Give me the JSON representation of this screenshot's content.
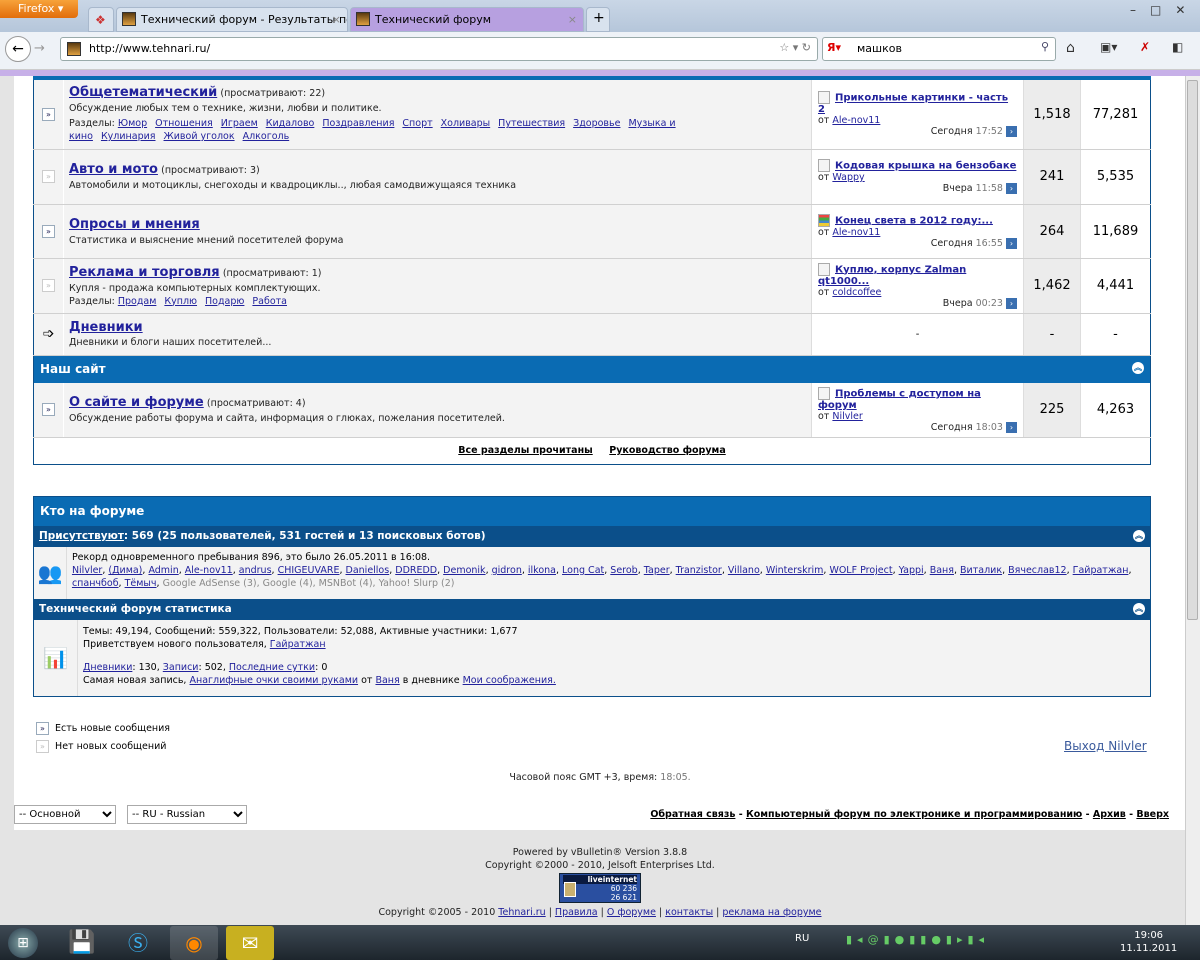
{
  "browser": {
    "menu": "Firefox",
    "tabs": [
      {
        "title": "Технический форум - Результаты поиска"
      },
      {
        "title": "Технический форум"
      }
    ],
    "url": "http://www.tehnari.ru/",
    "search_value": "машков",
    "new_tab": "+"
  },
  "forums": [
    {
      "title": "Общетематический",
      "viewing": "(просматривают: 22)",
      "desc": "Обсуждение любых тем о технике, жизни, любви и политике.",
      "subs_label": "Разделы:",
      "subs": [
        "Юмор",
        "Отношения",
        "Играем",
        "Кидалово",
        "Поздравления",
        "Спорт",
        "Холивары",
        "Путешествия",
        "Здоровье",
        "Музыка и кино",
        "Кулинария",
        "Живой уголок",
        "Алкоголь"
      ],
      "last_title": "Прикольные картинки - часть 2",
      "last_by": "от",
      "last_user": "Ale-nov11",
      "last_day": "Сегодня",
      "last_time": "17:52",
      "threads": "1,518",
      "posts": "77,281",
      "new": true
    },
    {
      "title": "Авто и мото",
      "viewing": "(просматривают: 3)",
      "desc": "Автомобили и мотоциклы, снегоходы и квадроциклы.., любая самодвижущаяся техника",
      "last_title": "Кодовая крышка на бензобаке",
      "last_by": "от",
      "last_user": "Wappy",
      "last_day": "Вчера",
      "last_time": "11:58",
      "threads": "241",
      "posts": "5,535",
      "new": false
    },
    {
      "title": "Опросы и мнения",
      "viewing": "",
      "desc": "Статистика и выяснение мнений посетителей форума",
      "last_title": "Конец света в 2012 году:...",
      "last_by": "от",
      "last_user": "Ale-nov11",
      "last_day": "Сегодня",
      "last_time": "16:55",
      "threads": "264",
      "posts": "11,689",
      "new": true
    },
    {
      "title": "Реклама и торговля",
      "viewing": "(просматривают: 1)",
      "desc": "Купля - продажа компьютерных комплектующих.",
      "subs_label": "Разделы:",
      "subs": [
        "Продам",
        "Куплю",
        "Подарю",
        "Работа"
      ],
      "last_title": "Куплю, корпус Zalman qt1000...",
      "last_by": "от",
      "last_user": "coldcoffee",
      "last_day": "Вчера",
      "last_time": "00:23",
      "threads": "1,462",
      "posts": "4,441",
      "new": false
    },
    {
      "title": "Дневники",
      "desc": "Дневники и блоги наших посетителей...",
      "last": "-",
      "threads": "-",
      "posts": "-"
    }
  ],
  "category2": {
    "title": "Наш сайт",
    "forum": {
      "title": "О сайте и форуме",
      "viewing": "(просматривают: 4)",
      "desc": "Обсуждение работы форума и сайта, информация о глюках, пожелания посетителей.",
      "last_title": "Проблемы с доступом на форум",
      "last_by": "от",
      "last_user": "Nilvler",
      "last_day": "Сегодня",
      "last_time": "18:03",
      "threads": "225",
      "posts": "4,263"
    }
  },
  "links": {
    "mark_read": "Все разделы прочитаны",
    "guide": "Руководство форума"
  },
  "who": {
    "title": "Кто на форуме",
    "present_link": "Присутствуют",
    "present_text": ": 569 (25 пользователей, 531 гостей и 13 поисковых ботов)",
    "record": "Рекорд одновременного пребывания 896, это было 26.05.2011 в 16:08.",
    "users": [
      "Nilvler",
      "(Дима)",
      "Admin",
      "Ale-nov11",
      "andrus",
      "CHIGEUVARE",
      "Daniellos",
      "DDREDD",
      "Demonik",
      "gidron",
      "ilkona",
      "Long Cat",
      "Serob",
      "Taper",
      "Tranzistor",
      "Villano",
      "Winterskrim",
      "WOLF Project",
      "Yappi",
      "Ваня",
      "Виталик",
      "Вячеслав12",
      "Гайратжан",
      "спанчбоб",
      "Тёмыч"
    ],
    "bots": "Google AdSense (3), Google (4), MSNBot (4), Yahoo! Slurp (2)"
  },
  "stats": {
    "title": "Технический форум статистика",
    "line1": "Темы: 49,194, Сообщений: 559,322, Пользователи: 52,088, Активные участники: 1,677",
    "welcome": "Приветствуем нового пользователя,",
    "new_user": "Гайратжан",
    "diaries": "Дневники",
    "diaries_val": ": 130,",
    "entries": "Записи",
    "entries_val": ": 502,",
    "last_day": "Последние сутки",
    "last_day_val": ": 0",
    "newest": "Самая новая запись,",
    "newest_link": "Анаглифные очки своими руками",
    "by": "от",
    "author": "Ваня",
    "in": "в дневнике",
    "diary": "Мои соображения."
  },
  "legend": {
    "new": "Есть новые сообщения",
    "old": "Нет новых сообщений"
  },
  "logout": "Выход Nilvler",
  "timezone": {
    "label": "Часовой пояс GMT +3, время:",
    "time": "18:05."
  },
  "footer": {
    "style": "-- Основной",
    "lang": "-- RU - Russian",
    "links": [
      "Обратная связь",
      "Компьютерный форум по электронике и программированию",
      "Архив",
      "Вверх"
    ],
    "powered": "Powered by vBulletin® Version 3.8.8",
    "copyright": "Copyright ©2000 - 2010, Jelsoft Enterprises Ltd.",
    "counter": {
      "brand": "liveinternet",
      "n1": "60 236",
      "n2": "26 621"
    },
    "site_copy": "Copyright ©2005 - 2010",
    "site_links": [
      "Tehnari.ru",
      "Правила",
      "О форуме",
      "контакты",
      "реклама на форуме"
    ]
  },
  "taskbar": {
    "lang": "RU",
    "time": "19:06",
    "date": "11.11.2011"
  }
}
